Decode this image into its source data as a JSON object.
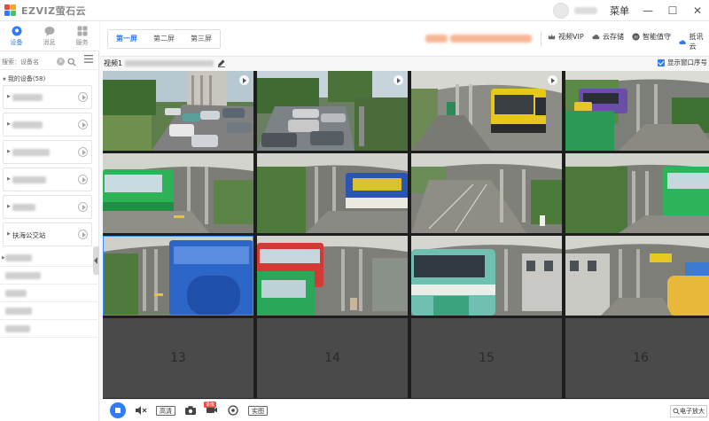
{
  "app": {
    "logo_text": "EZVIZ萤石云",
    "menu_label": "菜单"
  },
  "nav": [
    {
      "label": "设备",
      "icon": "device-icon",
      "active": true
    },
    {
      "label": "消息",
      "icon": "message-icon",
      "active": false
    },
    {
      "label": "服务",
      "icon": "service-icon",
      "active": false
    }
  ],
  "tabs": [
    {
      "label": "第一屏"
    },
    {
      "label": "第二屏"
    },
    {
      "label": "第三屏"
    }
  ],
  "toolbar": {
    "vip_label": "视频VIP",
    "cloud_storage_label": "云存储",
    "ai_label": "智能值守",
    "cloud_sync_label": "抵讯云"
  },
  "sidebar": {
    "search_placeholder": "搜索：设备名",
    "device_header": "我的设备(58)",
    "named_item": "扶海公交站"
  },
  "content": {
    "camera_title_prefix": "视频1",
    "show_window_number_label": "显示窗口序号",
    "empty_cells": [
      "13",
      "14",
      "15",
      "16"
    ]
  },
  "bottom": {
    "quality_label": "高清",
    "rec_badge": "录像",
    "fullscreen_label": "实图",
    "zoom_label": "电子放大"
  }
}
